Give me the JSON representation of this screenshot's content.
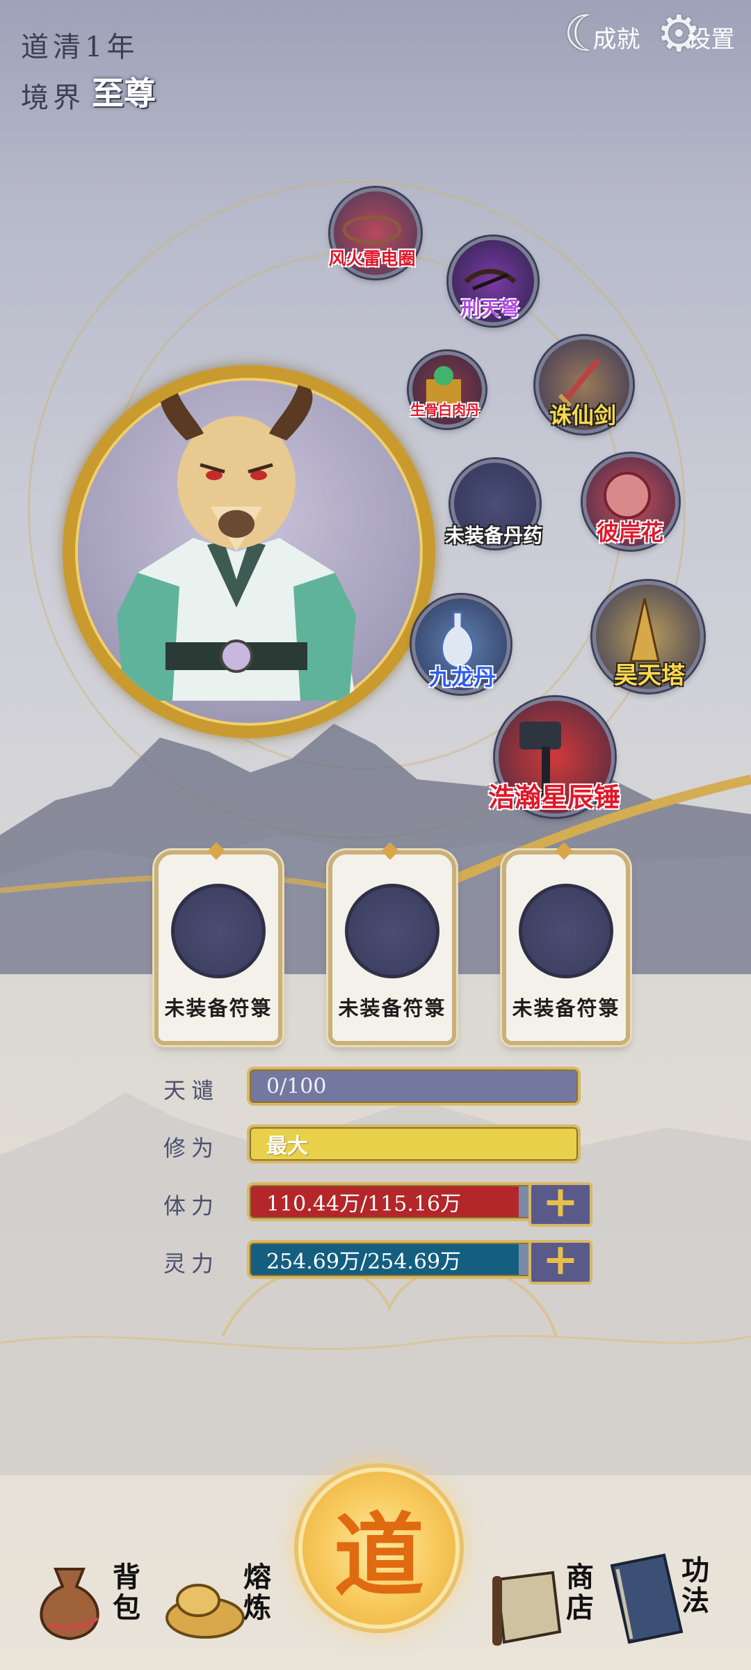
{
  "header": {
    "age_label": "道清1年",
    "realm_label": "境界",
    "realm_value": "至尊",
    "achievement_label": "成就",
    "settings_label": "设置"
  },
  "equipment": [
    {
      "name": "风火雷电圈",
      "icon": "ring-icon",
      "color": "red"
    },
    {
      "name": "刑天弩",
      "icon": "crossbow-icon",
      "color": "purple"
    },
    {
      "name": "生骨白肉丹",
      "icon": "treasure-chest-icon",
      "color": "red"
    },
    {
      "name": "诛仙剑",
      "icon": "sword-icon",
      "color": "yellow"
    },
    {
      "name": "未装备丹药",
      "icon": "empty-slot-icon",
      "color": "white"
    },
    {
      "name": "彼岸花",
      "icon": "orb-icon",
      "color": "red"
    },
    {
      "name": "九龙丹",
      "icon": "vase-icon",
      "color": "blue"
    },
    {
      "name": "昊天塔",
      "icon": "tower-icon",
      "color": "yellow"
    },
    {
      "name": "浩瀚星辰锤",
      "icon": "hammer-icon",
      "color": "red"
    }
  ],
  "talismans": [
    {
      "label": "未装备符箓"
    },
    {
      "label": "未装备符箓"
    },
    {
      "label": "未装备符箓"
    }
  ],
  "stats": {
    "heaven_label": "天谴",
    "heaven_value": "0/100",
    "heaven_fill": 1.0,
    "cultivation_label": "修为",
    "cultivation_value": "最大",
    "cultivation_fill": 1.0,
    "hp_label": "体力",
    "hp_value": "110.44万/115.16万",
    "hp_fill": 0.959,
    "mp_label": "灵力",
    "mp_value": "254.69万/254.69万",
    "mp_fill": 1.0
  },
  "nav": {
    "bag": "背包",
    "smelt": "熔炼",
    "center": "道",
    "shop": "商店",
    "skills": "功法"
  },
  "colors": {
    "heaven_bar": "#7478a0",
    "cultivation_bar": "#e8d04a",
    "hp_bar": "#b3262a",
    "mp_bar": "#145f80",
    "gold": "#c99a2e"
  }
}
